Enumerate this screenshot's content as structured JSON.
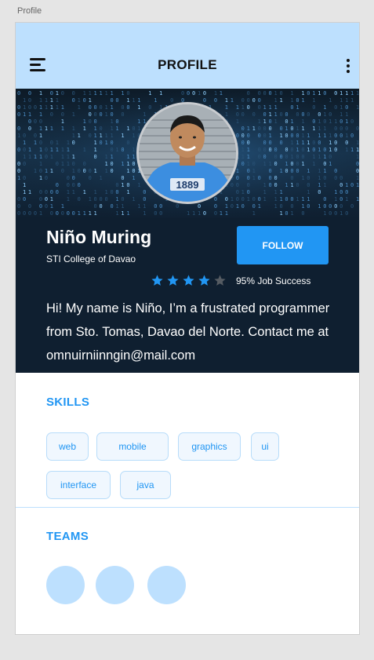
{
  "canvas": {
    "label": "Profile"
  },
  "appbar": {
    "title": "PROFILE",
    "menu_icon": "hamburger-icon",
    "more_icon": "more-vertical-icon",
    "background": "#bde0fe"
  },
  "profile": {
    "name": "Niño Muring",
    "school": "STI College of Davao",
    "follow_label": "FOLLOW",
    "rating": 4,
    "rating_max": 5,
    "job_success": "95% Job Success",
    "bio": "Hi! My name is Niño, I’m a frustrated programmer from Sto. Tomas, Davao del Norte. Contact me at omnuirniinngin@mail.com"
  },
  "skills": {
    "title": "SKILLS",
    "items": [
      "web",
      "mobile",
      "graphics",
      "ui",
      "interface",
      "java"
    ]
  },
  "teams": {
    "title": "TEAMS",
    "count": 3
  },
  "colors": {
    "accent": "#2196f3",
    "hero_bg": "#0f1f30",
    "chip_border": "#b7dcfa",
    "team_circle": "#bde0fe"
  }
}
